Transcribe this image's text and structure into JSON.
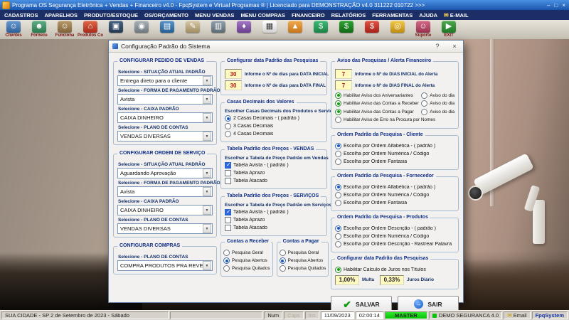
{
  "colors": {
    "titlebar_blue": "#1b56ae",
    "menubar_navy": "#1b2f66",
    "selected_blue": "#1558c0",
    "selected_green": "#12a012",
    "checkbox_blue": "#2a66d8",
    "field_yellow": "#fffac0",
    "field_value_red": "#a81818",
    "master_green": "#09c009"
  },
  "titlebar": {
    "title": "Programa OS Segurança Eletrônica + Vendas + Financeiro v4.0 - FpqSystem e Virtual Programas ® | Licenciado para DEMONSTRAÇÃO v4.0 311222 010722 >>>",
    "minimize": "–",
    "maximize": "□",
    "close": "×"
  },
  "menubar": {
    "items": [
      "CADASTROS",
      "APARELHOS",
      "PRODUTO/ESTOQUE",
      "OS/ORÇAMENTO",
      "MENU VENDAS",
      "MENU COMPRAS",
      "FINANCEIRO",
      "RELATÓRIOS",
      "FERRAMENTAS",
      "AJUDA",
      "E-MAIL"
    ]
  },
  "toolbar": {
    "buttons": [
      {
        "label": "Clientes",
        "glyph": "☺"
      },
      {
        "label": "Fornece",
        "glyph": "☻"
      },
      {
        "label": "Funciona",
        "glyph": "☺"
      },
      {
        "label": "Produtos Consert",
        "glyph": "⌂"
      },
      {
        "label": "",
        "glyph": "▣"
      },
      {
        "label": "",
        "glyph": "◉"
      },
      {
        "label": "",
        "glyph": "▤"
      },
      {
        "label": "",
        "glyph": "✎"
      },
      {
        "label": "",
        "glyph": "▥"
      },
      {
        "label": "",
        "glyph": "♦"
      },
      {
        "label": "",
        "glyph": "▦"
      },
      {
        "label": "",
        "glyph": "▲"
      },
      {
        "label": "",
        "glyph": "$"
      },
      {
        "label": "",
        "glyph": "$"
      },
      {
        "label": "",
        "glyph": "$"
      },
      {
        "label": "",
        "glyph": "◎"
      },
      {
        "label": "Suporte",
        "glyph": "☺"
      },
      {
        "label": "EXIT",
        "glyph": "▶"
      }
    ]
  },
  "dialog": {
    "title": "Configuração Padrão do Sistema",
    "help": "?",
    "close": "×",
    "col1": {
      "g1": {
        "title": "CONFIGURAR PEDIDO DE VENDAS",
        "f1_label": "Selecione - SITUAÇÃO ATUAL PADRÃO",
        "f1_value": "Entrega direto para o cliente",
        "f2_label": "Selecione - FORMA DE PAGAMENTO PADRÃO",
        "f2_value": "Avista",
        "f3_label": "Selecione - CAIXA PADRÃO",
        "f3_value": "CAIXA DINHEIRO",
        "f4_label": "Selecione - PLANO DE CONTAS",
        "f4_value": "VENDAS DIVERSAS"
      },
      "g2": {
        "title": "CONFIGURAR ORDEM DE SERVIÇO",
        "f1_label": "Selecione - SITUAÇÃO ATUAL PADRÃO",
        "f1_value": "Aguardando Aprovação",
        "f2_label": "Selecione - FORMA DE PAGAMENTO PADRÃO",
        "f2_value": "Avista",
        "f3_label": "Selecione - CAIXA PADRÃO",
        "f3_value": "CAIXA DINHEIRO",
        "f4_label": "Selecione - PLANO DE CONTAS",
        "f4_value": "VENDAS DIVERSAS"
      },
      "g3": {
        "title": "CONFIGURAR COMPRAS",
        "f1_label": "Selecione - PLANO DE CONTAS",
        "f1_value": "COMPRA PRODUTOS PRA REVENDA"
      }
    },
    "col2": {
      "datas": {
        "title": "Configurar data Padrão das Pesquisas",
        "v1": "30",
        "l1": "Informe o Nº de dias para DATA INICIAL",
        "v2": "30",
        "l2": "Informe o Nº de dias para DATA FINAL"
      },
      "casas": {
        "title": "Casas Decimais dos Valores",
        "subtitle": "Escolher Casas Decimais dos Produtos e Serviços",
        "o1": {
          "label": "2 Casas Decimais - ( padrão )",
          "sel": true
        },
        "o2": {
          "label": "3 Casas Decimais",
          "sel": false
        },
        "o3": {
          "label": "4 Casas Decimais",
          "sel": false
        }
      },
      "tab_vendas": {
        "title": "Tabela Padrão dos Preços - VENDAS",
        "subtitle": "Escolher a Tabela de Preço Padrão em Vendas",
        "o1": {
          "label": "Tabela Avista - ( padrão )",
          "sel": true
        },
        "o2": {
          "label": "Tabela Aprazo",
          "sel": false
        },
        "o3": {
          "label": "Tabela Atacado",
          "sel": false
        }
      },
      "tab_servicos": {
        "title": "Tabela Padrão dos Preços - SERVIÇOS",
        "subtitle": "Escolher a Tabela de Preço Padrão em Serviços",
        "o1": {
          "label": "Tabela Avista - ( padrão )",
          "sel": true
        },
        "o2": {
          "label": "Tabela Aprazo",
          "sel": false
        },
        "o3": {
          "label": "Tabela Atacado",
          "sel": false
        }
      },
      "receber": {
        "title": "Contas a Receber",
        "o1": {
          "label": "Pesquisa Geral",
          "sel": false
        },
        "o2": {
          "label": "Pesquisa Abertos",
          "sel": true
        },
        "o3": {
          "label": "Pesquisa Quitados",
          "sel": false
        }
      },
      "pagar": {
        "title": "Contas a Pagar",
        "o1": {
          "label": "Pesquisa Geral",
          "sel": false
        },
        "o2": {
          "label": "Pesquisa Abertos",
          "sel": true
        },
        "o3": {
          "label": "Pesquisa Quitados",
          "sel": false
        }
      }
    },
    "col3": {
      "alerta": {
        "title": "Aviso das Pesquisas / Alerta Financeiro",
        "v1": "7",
        "l1": "Informe o Nº de DIAS INICIAL do Alerta",
        "v2": "7",
        "l2": "Informe o Nº de DIAS FINAL do Alerta",
        "o1": {
          "label": "Habilitar Aviso dos Aniversariantes",
          "sel": true,
          "extra": "Aviso do dia",
          "extra_sel": false
        },
        "o2": {
          "label": "Habilitar Aviso das Contas a Receber",
          "sel": true,
          "extra": "Aviso do dia",
          "extra_sel": false
        },
        "o3": {
          "label": "Habilitar Aviso das Contas a Pagar",
          "sel": true,
          "extra": "Aviso do dia",
          "extra_sel": false
        },
        "o4": {
          "label": "Habilitar Aviso de Erro na Procura por Nomes",
          "sel": false
        }
      },
      "ordem_cliente": {
        "title": "Ordem Padrão da Pesquisa - Cliente",
        "o1": {
          "label": "Escolha por Ordem Alfabética - ( padrão )",
          "sel": true
        },
        "o2": {
          "label": "Escolha por Ordem Numérica / Código",
          "sel": false
        },
        "o3": {
          "label": "Escolha por Ordem Fantasia",
          "sel": false
        }
      },
      "ordem_fornecedor": {
        "title": "Ordem Padrão da Pesquisa - Fornecedor",
        "o1": {
          "label": "Escolha por Ordem Alfabética - ( padrão )",
          "sel": true
        },
        "o2": {
          "label": "Escolha por Ordem Numérica / Código",
          "sel": false
        },
        "o3": {
          "label": "Escolha por Ordem Fantasia",
          "sel": false
        }
      },
      "ordem_produtos": {
        "title": "Ordem Padrão da Pesquisa - Produtos",
        "o1": {
          "label": "Escolha por Ordem Descrição - ( padrão )",
          "sel": true
        },
        "o2": {
          "label": "Escolha por Ordem Numérica / Código",
          "sel": false
        },
        "o3": {
          "label": "Escolha por Ordem Descrição - Rastrear Palavra",
          "sel": false
        }
      },
      "juros": {
        "title": "Configurar data Padrão das Pesquisas",
        "check": {
          "label": "Habilitar Calculo de Juros nos Títulos",
          "sel": true
        },
        "multa_value": "1,00%",
        "multa_label": "Multa",
        "juros_value": "0,33%",
        "juros_label": "Juros Diário"
      },
      "salvar": "SALVAR",
      "sair": "SAIR"
    }
  },
  "statusbar": {
    "location": "SUA CIDADE - SP  2 de Setembro de 2023 - Sábado",
    "num": "Num",
    "caps": "Caps",
    "ins": "Ins",
    "date": "11/09/2023",
    "time": "02:00:14",
    "user": "MASTER",
    "app": "DEMO SEGURANCA 4.0",
    "email": "Email",
    "brand": "FpqSystem"
  }
}
